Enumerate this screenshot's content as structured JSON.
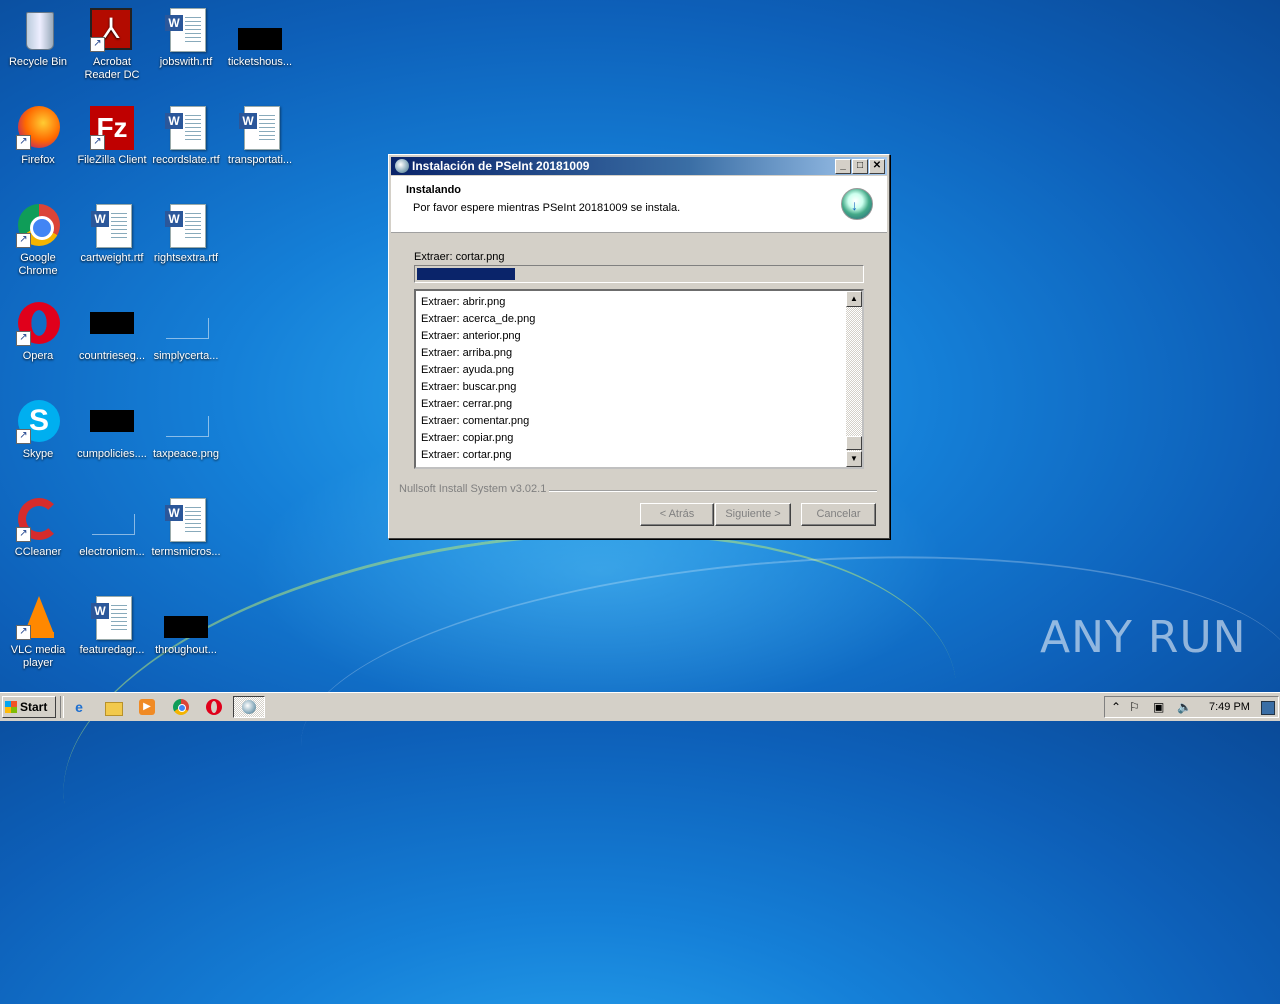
{
  "desktop": {
    "icons": [
      {
        "label": "Recycle Bin",
        "icon": "recycle-bin-icon"
      },
      {
        "label": "Acrobat Reader DC",
        "icon": "acrobat-icon"
      },
      {
        "label": "jobswith.rtf",
        "icon": "word-doc-icon"
      },
      {
        "label": "ticketshous...",
        "icon": "redacted-thumbnail"
      },
      {
        "label": "Firefox",
        "icon": "firefox-icon"
      },
      {
        "label": "FileZilla Client",
        "icon": "filezilla-icon"
      },
      {
        "label": "recordslate.rtf",
        "icon": "word-doc-icon"
      },
      {
        "label": "transportati...",
        "icon": "word-doc-icon"
      },
      {
        "label": "Google Chrome",
        "icon": "chrome-icon"
      },
      {
        "label": "cartweight.rtf",
        "icon": "word-doc-icon"
      },
      {
        "label": "rightsextra.rtf",
        "icon": "word-doc-icon"
      },
      {
        "label": "Opera",
        "icon": "opera-icon"
      },
      {
        "label": "countrieseg...",
        "icon": "redacted-thumbnail"
      },
      {
        "label": "simplycerta...",
        "icon": "blank-file-icon"
      },
      {
        "label": "Skype",
        "icon": "skype-icon"
      },
      {
        "label": "cumpolicies....",
        "icon": "redacted-thumbnail"
      },
      {
        "label": "taxpeace.png",
        "icon": "blank-file-icon"
      },
      {
        "label": "CCleaner",
        "icon": "ccleaner-icon"
      },
      {
        "label": "electronicm...",
        "icon": "blank-file-icon"
      },
      {
        "label": "termsmicros...",
        "icon": "word-doc-icon"
      },
      {
        "label": "VLC media player",
        "icon": "vlc-icon"
      },
      {
        "label": "featuredagr...",
        "icon": "word-doc-icon"
      },
      {
        "label": "throughout...",
        "icon": "redacted-thumbnail"
      }
    ]
  },
  "dialog": {
    "title": "Instalación de PSeInt 20181009",
    "heading": "Instalando",
    "subheading": "Por favor espere mientras PSeInt 20181009 se instala.",
    "status": "Extraer: cortar.png",
    "progress_fraction": 0.22,
    "log": [
      "Extraer: abrir.png",
      "Extraer: acerca_de.png",
      "Extraer: anterior.png",
      "Extraer: arriba.png",
      "Extraer: ayuda.png",
      "Extraer: buscar.png",
      "Extraer: cerrar.png",
      "Extraer: comentar.png",
      "Extraer: copiar.png",
      "Extraer: cortar.png"
    ],
    "branding": "Nullsoft Install System v3.02.1",
    "buttons": {
      "back": "< Atrás",
      "next": "Siguiente >",
      "cancel": "Cancelar"
    }
  },
  "taskbar": {
    "start_label": "Start",
    "clock": "7:49 PM"
  },
  "watermark": "ANY RUN"
}
